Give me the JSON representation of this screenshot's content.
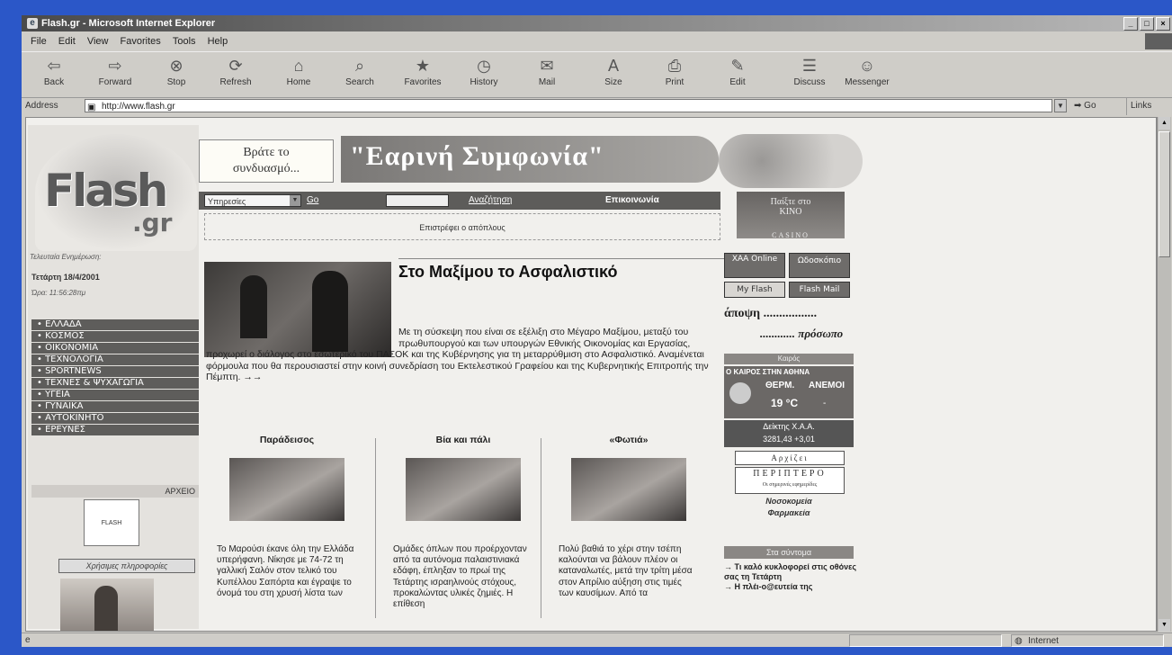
{
  "window": {
    "title": "Flash.gr - Microsoft Internet Explorer",
    "controls": [
      "_",
      "□",
      "×"
    ]
  },
  "menu": [
    "File",
    "Edit",
    "View",
    "Favorites",
    "Tools",
    "Help"
  ],
  "toolbar": [
    {
      "label": "Back",
      "icon": "back-arrow-icon",
      "glyph": "⇦"
    },
    {
      "label": "Forward",
      "icon": "forward-arrow-icon",
      "glyph": "⇨"
    },
    {
      "label": "Stop",
      "icon": "stop-icon",
      "glyph": "⊗"
    },
    {
      "label": "Refresh",
      "icon": "refresh-icon",
      "glyph": "⟳"
    },
    {
      "label": "Home",
      "icon": "home-icon",
      "glyph": "⌂"
    },
    {
      "label": "Search",
      "icon": "search-icon",
      "glyph": "⌕"
    },
    {
      "label": "Favorites",
      "icon": "favorites-icon",
      "glyph": "★"
    },
    {
      "label": "History",
      "icon": "history-icon",
      "glyph": "◷"
    },
    {
      "label": "Mail",
      "icon": "mail-icon",
      "glyph": "✉"
    },
    {
      "label": "Size",
      "icon": "size-icon",
      "glyph": "A"
    },
    {
      "label": "Print",
      "icon": "print-icon",
      "glyph": "⎙"
    },
    {
      "label": "Edit",
      "icon": "edit-icon",
      "glyph": "✎"
    },
    {
      "label": "Discuss",
      "icon": "discuss-icon",
      "glyph": "☰"
    },
    {
      "label": "Messenger",
      "icon": "messenger-icon",
      "glyph": "☺"
    }
  ],
  "address": {
    "label": "Address",
    "url": "http://www.flash.gr",
    "go": "Go",
    "links": "Links"
  },
  "status": {
    "zone": "Internet"
  },
  "page": {
    "logo_main": "Flash",
    "logo_sub": ".gr",
    "last_update_label": "Τελευταία Ενημέρωση:",
    "date": "Τετάρτη 18/4/2001",
    "time": "Ώρα: 11:56:28πμ",
    "nav": [
      "ΕΛΛΑΔΑ",
      "ΚΟΣΜΟΣ",
      "ΟΙΚΟΝΟΜΙΑ",
      "ΤΕΧΝΟΛΟΓΙΑ",
      "SPORTNEWS",
      "ΤΕΧΝΕΣ & ΨΥΧΑΓΩΓΙΑ",
      "ΥΓΕΙΑ",
      "ΓΥΝΑΙΚΑ",
      "ΑΥΤΟΚΙΝΗΤΟ",
      "ΕΡΕΥΝΕΣ"
    ],
    "archive": "ΑΡΧΕΙΟ",
    "archive_img_text": "FLASH",
    "knowledge_btn": "Χρήσιμες πληροφορίες",
    "banner_box": [
      "Βράτε το",
      "συνδυασμό..."
    ],
    "banner_title": "\"Εαρινή Συμφωνία\"",
    "services_select": "Υπηρεσίες",
    "go_link": "Go",
    "search_link": "Αναζήτηση",
    "contact_link": "Επικοινωνία",
    "ticker": "Επιστρέφει ο απόπλους",
    "casino": [
      "Παίξτε στο",
      "KINO",
      "CASINO"
    ],
    "headline": "Στο Μαξίμου το Ασφαλιστικό",
    "story_a": "Με τη σύσκεψη που είναι σε εξέλιξη στο Μέγαρο Μαξίμου, μεταξύ του πρωθυπουργού και των υπουργών Εθνικής Οικονομίας και Εργασίας,",
    "story_b": "προχωρεί ο διάλογος στο εσωτερικό του ΠΑΣΟΚ και της Κυβέρνησης για τη μεταρρύθμιση στο Ασφαλιστικό. Αναμένεται φόρμουλα που θα περουσιαστεί στην κοινή συνεδρίαση του Εκτελεστικού Γραφείου και της Κυβερνητικής Επιτροπής την Πέμπτη. →→",
    "columns": [
      {
        "title": "Παράδεισος",
        "text": "Το Μαρούσι έκανε όλη την Ελλάδα υπερήφανη. Νίκησε με 74-72 τη γαλλική Σαλόν στον τελικό του Κυπέλλου Σαπόρτα και έγραψε το όνομά του στη χρυσή λίστα των"
      },
      {
        "title": "Βία και πάλι",
        "text": "Ομάδες όπλων που προέρχονταν από τα αυτόνομα παλαιστινιακά εδάφη, έπληξαν το πρωί της Τετάρτης ισραηλινούς στόχους, προκαλώντας υλικές ζημιές. Η επίθεση"
      },
      {
        "title": "«Φωτιά»",
        "text": "Πολύ βαθιά το χέρι στην τσέπη καλούνται να βάλουν πλέον οι καταναλωτές, μετά την τρίτη μέσα στον Απρίλιο αύξηση στις τιμές των καυσίμων. Από τα"
      }
    ],
    "right": {
      "xaa_online": "ΧΑΑ Online",
      "horoscope": "Ωδοσκόπιο",
      "myflash": "My Flash",
      "flashmail": "Flash Mail",
      "opinion": "άποψη .................",
      "face": "............ πρόσωπο",
      "weather_head": "Καιρός",
      "weather_city": "Ο ΚΑΙΡΟΣ ΣΤΗΝ ΑΘΗΝΑ",
      "weather_temp_label": "ΘΕΡΜ.",
      "weather_wind_label": "ΑΝΕΜΟΙ",
      "weather_temp": "19 °C",
      "weather_wind": "-",
      "stock_label": "Δείκτης Χ.Α.Α.",
      "stock_value": "3281,43   +3,01",
      "arxise": "Αρχίζει",
      "periptero": "ΠΕΡΙΠΤΕΡΟ",
      "periptero_sub": "Οι σημερινές εφημερίδες",
      "hospitals": [
        "Νοσοκομεία",
        "Φαρμακεία"
      ],
      "smallnews_head": "Στα σύντομα",
      "smallnews": [
        "→ Τι καλό κυκλοφορεί στις οθόνες σας τη Τετάρτη",
        "→ Η πλέι-ο@ευτεία της"
      ]
    }
  }
}
